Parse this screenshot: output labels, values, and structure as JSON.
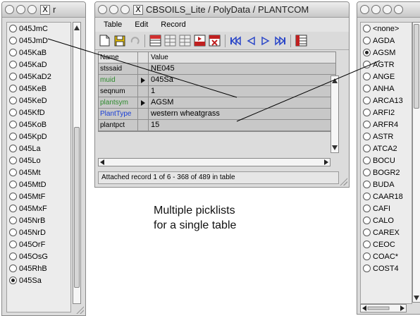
{
  "left_window": {
    "title_glyph": "r",
    "items": [
      {
        "label": "045JmC",
        "selected": false
      },
      {
        "label": "045JmD",
        "selected": false
      },
      {
        "label": "045KaB",
        "selected": false
      },
      {
        "label": "045KaD",
        "selected": false
      },
      {
        "label": "045KaD2",
        "selected": false
      },
      {
        "label": "045KeB",
        "selected": false
      },
      {
        "label": "045KeD",
        "selected": false
      },
      {
        "label": "045KfD",
        "selected": false
      },
      {
        "label": "045KoB",
        "selected": false
      },
      {
        "label": "045KpD",
        "selected": false
      },
      {
        "label": "045La",
        "selected": false
      },
      {
        "label": "045Lo",
        "selected": false
      },
      {
        "label": "045Mt",
        "selected": false
      },
      {
        "label": "045MtD",
        "selected": false
      },
      {
        "label": "045MtF",
        "selected": false
      },
      {
        "label": "045MxF",
        "selected": false
      },
      {
        "label": "045NrB",
        "selected": false
      },
      {
        "label": "045NrD",
        "selected": false
      },
      {
        "label": "045OrF",
        "selected": false
      },
      {
        "label": "045OsG",
        "selected": false
      },
      {
        "label": "045RhB",
        "selected": false
      },
      {
        "label": "045Sa",
        "selected": true
      }
    ]
  },
  "main_window": {
    "title": "CBSOILS_Lite / PolyData / PLANTCOM",
    "menu": [
      "Table",
      "Edit",
      "Record"
    ],
    "grid_header": {
      "name": "Name",
      "value": "Value"
    },
    "rows": [
      {
        "name": "stssaid",
        "value": "NE045",
        "name_color": "#000000",
        "pointer": false
      },
      {
        "name": "muid",
        "value": "045Sa",
        "name_color": "#2e8b2e",
        "pointer": true
      },
      {
        "name": "seqnum",
        "value": "1",
        "name_color": "#000000",
        "pointer": false
      },
      {
        "name": "plantsym",
        "value": "AGSM",
        "name_color": "#2e8b2e",
        "pointer": true
      },
      {
        "name": "PlantType",
        "value": "western wheatgrass",
        "name_color": "#1a3fd6",
        "pointer": false
      },
      {
        "name": "plantpct",
        "value": "15",
        "name_color": "#000000",
        "pointer": false
      }
    ],
    "status": "Attached record 1 of 6 - 368 of 489 in table"
  },
  "caption": {
    "line1": "Multiple picklists",
    "line2": "for a single table"
  },
  "right_window": {
    "items": [
      {
        "label": "<none>",
        "selected": false
      },
      {
        "label": "AGDA",
        "selected": false
      },
      {
        "label": "AGSM",
        "selected": true
      },
      {
        "label": "AGTR",
        "selected": false
      },
      {
        "label": "ANGE",
        "selected": false
      },
      {
        "label": "ANHA",
        "selected": false
      },
      {
        "label": "ARCA13",
        "selected": false
      },
      {
        "label": "ARFI2",
        "selected": false
      },
      {
        "label": "ARFR4",
        "selected": false
      },
      {
        "label": "ASTR",
        "selected": false
      },
      {
        "label": "ATCA2",
        "selected": false
      },
      {
        "label": "BOCU",
        "selected": false
      },
      {
        "label": "BOGR2",
        "selected": false
      },
      {
        "label": "BUDA",
        "selected": false
      },
      {
        "label": "CAAR18",
        "selected": false
      },
      {
        "label": "CAFI",
        "selected": false
      },
      {
        "label": "CALO",
        "selected": false
      },
      {
        "label": "CAREX",
        "selected": false
      },
      {
        "label": "CEOC",
        "selected": false
      },
      {
        "label": "COAC*",
        "selected": false
      },
      {
        "label": "COST4",
        "selected": false
      }
    ]
  }
}
